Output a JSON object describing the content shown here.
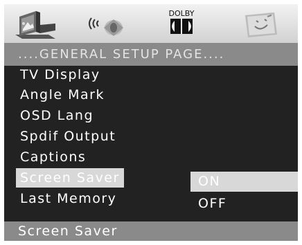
{
  "icons": [
    {
      "name": "general-setup-icon",
      "selected": true
    },
    {
      "name": "audio-speaker-icon",
      "selected": false
    },
    {
      "name": "dolby-icon",
      "label": "DOLBY",
      "selected": false
    },
    {
      "name": "preference-face-icon",
      "selected": false
    }
  ],
  "title": "....GENERAL SETUP PAGE....",
  "menu": {
    "items": [
      {
        "label": "TV Display"
      },
      {
        "label": "Angle Mark"
      },
      {
        "label": "OSD Lang"
      },
      {
        "label": "Spdif Output"
      },
      {
        "label": "Captions"
      },
      {
        "label": "Screen Saver"
      },
      {
        "label": "Last Memory"
      }
    ],
    "selected_index": 5
  },
  "options": {
    "items": [
      {
        "label": "ON"
      },
      {
        "label": "OFF"
      }
    ],
    "selected_index": 0
  },
  "status": "Screen Saver",
  "colors": {
    "background": "#222222",
    "bar": "#8a8a8a",
    "highlight": "#d8d8d8",
    "text": "#ffffff"
  }
}
